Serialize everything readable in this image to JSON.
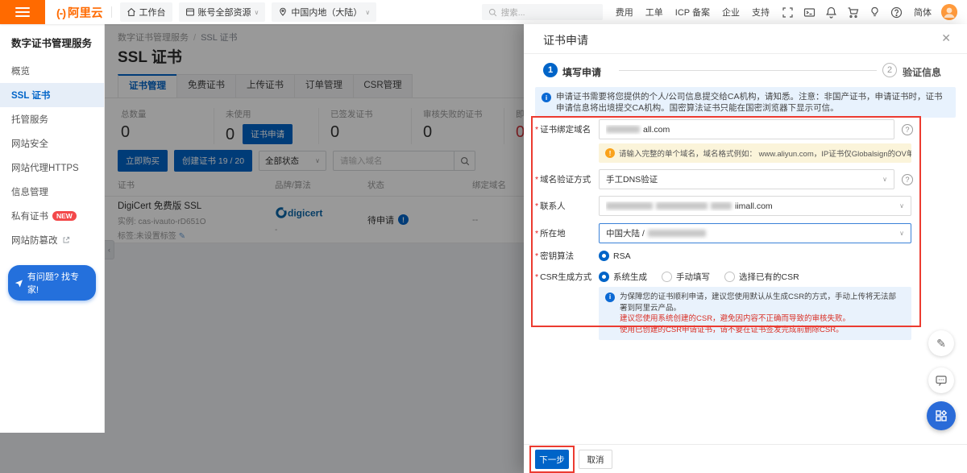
{
  "colors": {
    "brand_orange": "#ff6a00",
    "accent_blue": "#0064c8",
    "danger_red": "#d9363e",
    "annotation_red": "#ec3b30",
    "mask": "rgba(0,0,0,0.40)"
  },
  "topbar": {
    "logo_mark": "(-)",
    "logo_text": "阿里云",
    "workbench": "工作台",
    "account_scope": "账号全部资源",
    "region": "中国内地（大陆）",
    "search_placeholder": "搜索...",
    "menu": [
      "费用",
      "工单",
      "ICP 备案",
      "企业",
      "支持"
    ],
    "lang": "简体"
  },
  "sidebar": {
    "title": "数字证书管理服务",
    "items": [
      {
        "label": "概览"
      },
      {
        "label": "SSL 证书",
        "active": true
      },
      {
        "label": "托管服务"
      },
      {
        "label": "网站安全"
      },
      {
        "label": "网站代理HTTPS"
      },
      {
        "label": "信息管理"
      },
      {
        "label": "私有证书",
        "badge": "NEW"
      },
      {
        "label": "网站防篡改",
        "external": true
      }
    ],
    "expert_button": "有问题? 找专家!"
  },
  "main": {
    "breadcrumb": {
      "root": "数字证书管理服务",
      "sep": "/",
      "current": "SSL 证书"
    },
    "title": "SSL 证书",
    "tabs": [
      {
        "label": "证书管理",
        "active": true
      },
      {
        "label": "免费证书"
      },
      {
        "label": "上传证书"
      },
      {
        "label": "订单管理"
      },
      {
        "label": "CSR管理"
      }
    ],
    "stats": [
      {
        "label": "总数量",
        "value": "0"
      },
      {
        "label": "未使用",
        "value": "0",
        "action": "证书申请"
      },
      {
        "label": "已签发证书",
        "value": "0"
      },
      {
        "label": "审核失败的证书",
        "value": "0"
      },
      {
        "label": "即将过期的",
        "value": "0",
        "danger": true
      }
    ],
    "toolbar": {
      "buy": "立即购买",
      "create": "创建证书 19 / 20",
      "status_filter": "全部状态",
      "search_placeholder": "请输入域名"
    },
    "table": {
      "columns": [
        "证书",
        "品牌/算法",
        "状态",
        "绑定域名"
      ],
      "row": {
        "name": "DigiCert 免费版 SSL",
        "instance": "实例: cas-ivauto-rD651O",
        "tag": "标签:未设置标签",
        "brand": "digicert",
        "brand_algo": "-",
        "status": "待申请",
        "domain": "--"
      }
    },
    "collapse_glyph": "‹"
  },
  "drawer": {
    "title": "证书申请",
    "close_glyph": "✕",
    "required_mark": "*",
    "steps": [
      {
        "num": "1",
        "label": "填写申请",
        "active": true
      },
      {
        "num": "2",
        "label": "验证信息"
      }
    ],
    "notice": "申请证书需要将您提供的个人/公司信息提交给CA机构，请知悉。注意：非国产证书，申请证书时，证书申请信息将出境提交CA机构。国密算法证书只能在国密浏览器下显示可信。",
    "fields": {
      "domain_label": "证书绑定域名",
      "domain_value_visible": "all.com",
      "domain_redacted": true,
      "domain_warning": "请输入完整的单个域名，域名格式例如： www.aliyun.com，IP证书仅Globalsign的OV单域名证书支持。",
      "verify_label": "域名验证方式",
      "verify_value": "手工DNS验证",
      "contact_label": "联系人",
      "contact_value_visible": "iimall.com",
      "contact_redacted": true,
      "location_label": "所在地",
      "location_value_visible": "中国大陆 / ",
      "location_redacted": true,
      "key_algo_label": "密钥算法",
      "key_algo_value": "RSA",
      "csr_label": "CSR生成方式",
      "csr_options": [
        "系统生成",
        "手动填写",
        "选择已有的CSR"
      ],
      "csr_selected": "系统生成",
      "csr_notice_1": "为保障您的证书顺利申请，建议您使用默认从生成CSR的方式，手动上传将无法部署到阿里云产品。",
      "csr_notice_2": "建议您使用系统创建的CSR，避免因内容不正确而导致的审核失败。",
      "csr_notice_3": "使用已创建的CSR申请证书，请不要在证书签发完成前删除CSR。"
    },
    "footer": {
      "next": "下一步",
      "cancel": "取消"
    }
  }
}
